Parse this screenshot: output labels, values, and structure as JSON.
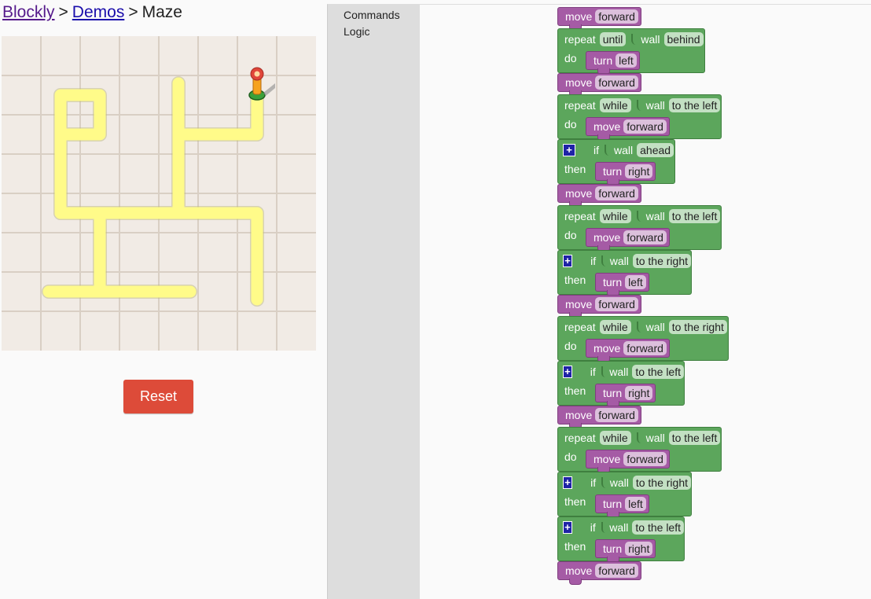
{
  "breadcrumb": {
    "link1": "Blockly",
    "sep1": ">",
    "link2": "Demos",
    "sep2": ">",
    "current": "Maze"
  },
  "controls": {
    "reset_label": "Reset"
  },
  "toolbox": {
    "categories": [
      "Commands",
      "Logic"
    ]
  },
  "colors": {
    "path": "#fffb89",
    "grid_bg": "#f1ebe5",
    "grid_line": "#d9cfc4",
    "motion_block": "#a55ba5",
    "logic_block": "#5ca65c",
    "reset": "#dd4b39"
  },
  "workspace": {
    "kw": {
      "move": "move",
      "forward": "forward",
      "repeat": "repeat",
      "do": "do",
      "wall": "wall",
      "if": "if",
      "then": "then",
      "turn": "turn",
      "plus": "+"
    },
    "blocks": [
      {
        "type": "move",
        "dir": "forward"
      },
      {
        "type": "repeat",
        "mode": "until",
        "wall": "behind",
        "body": {
          "type": "turn",
          "dir": "left"
        }
      },
      {
        "type": "move",
        "dir": "forward"
      },
      {
        "type": "repeat",
        "mode": "while",
        "wall": "to the left",
        "body": {
          "type": "move",
          "dir": "forward"
        }
      },
      {
        "type": "if",
        "wall": "ahead",
        "body": {
          "type": "turn",
          "dir": "right"
        }
      },
      {
        "type": "move",
        "dir": "forward"
      },
      {
        "type": "repeat",
        "mode": "while",
        "wall": "to the left",
        "body": {
          "type": "move",
          "dir": "forward"
        }
      },
      {
        "type": "if",
        "wall": "to the right",
        "body": {
          "type": "turn",
          "dir": "left"
        }
      },
      {
        "type": "move",
        "dir": "forward"
      },
      {
        "type": "repeat",
        "mode": "while",
        "wall": "to the right",
        "body": {
          "type": "move",
          "dir": "forward"
        }
      },
      {
        "type": "if",
        "wall": "to the left",
        "body": {
          "type": "turn",
          "dir": "right"
        }
      },
      {
        "type": "move",
        "dir": "forward"
      },
      {
        "type": "repeat",
        "mode": "while",
        "wall": "to the left",
        "body": {
          "type": "move",
          "dir": "forward"
        }
      },
      {
        "type": "if",
        "wall": "to the right",
        "body": {
          "type": "turn",
          "dir": "left"
        }
      },
      {
        "type": "if",
        "wall": "to the left",
        "body": {
          "type": "turn",
          "dir": "right"
        }
      },
      {
        "type": "move",
        "dir": "forward"
      }
    ]
  }
}
